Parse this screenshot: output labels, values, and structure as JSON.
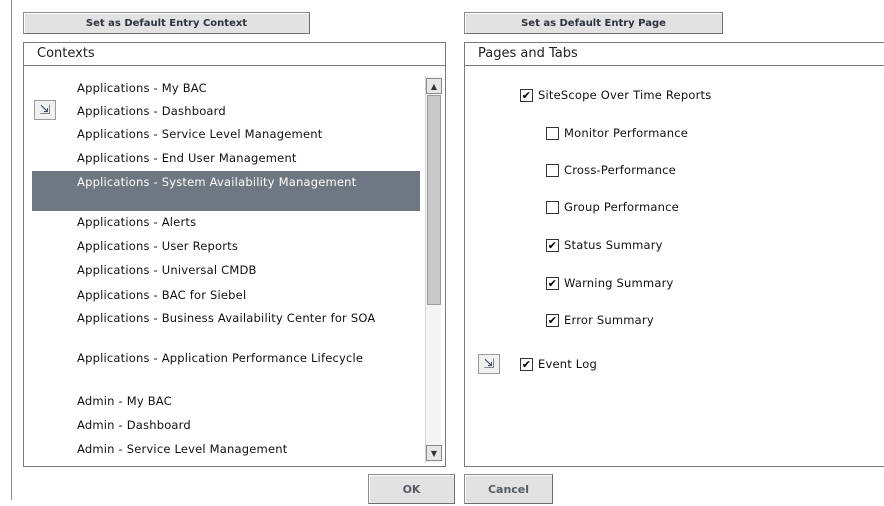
{
  "buttons": {
    "set_default_context": "Set as Default Entry Context",
    "set_default_page": "Set as Default Entry Page",
    "ok": "OK",
    "cancel": "Cancel"
  },
  "contexts": {
    "header": "Contexts",
    "items": [
      {
        "label": "Applications - My BAC"
      },
      {
        "label": "Applications - Dashboard",
        "default": true
      },
      {
        "label": "Applications - Service Level Management"
      },
      {
        "label": "Applications - End User Management"
      },
      {
        "label": "Applications - System Availability Management",
        "selected": true
      },
      {
        "label": "Applications - Alerts"
      },
      {
        "label": "Applications - User Reports"
      },
      {
        "label": "Applications - Universal CMDB"
      },
      {
        "label": "Applications - BAC for Siebel"
      },
      {
        "label": "Applications - Business Availability Center for SOA"
      },
      {
        "label": "Applications - Application Performance Lifecycle"
      },
      {
        "label": "Admin - My BAC"
      },
      {
        "label": "Admin - Dashboard"
      },
      {
        "label": "Admin - Service Level Management"
      }
    ]
  },
  "pages": {
    "header": "Pages and Tabs",
    "items": [
      {
        "label": "SiteScope Over Time Reports",
        "checked": true,
        "level": 0
      },
      {
        "label": "Monitor Performance",
        "checked": false,
        "level": 1
      },
      {
        "label": "Cross-Performance",
        "checked": false,
        "level": 1
      },
      {
        "label": "Group Performance",
        "checked": false,
        "level": 1
      },
      {
        "label": "Status Summary",
        "checked": true,
        "level": 1
      },
      {
        "label": "Warning Summary",
        "checked": true,
        "level": 1
      },
      {
        "label": "Error Summary",
        "checked": true,
        "level": 1
      },
      {
        "label": "Event Log",
        "checked": true,
        "level": 0,
        "default": true
      }
    ]
  },
  "icons": {
    "default_entry": "default-entry-icon",
    "scroll_up": "scroll-up-arrow-icon",
    "scroll_down": "scroll-down-arrow-icon"
  },
  "colors": {
    "selection": "#6f7782",
    "button_face": "#e2e2e2"
  }
}
